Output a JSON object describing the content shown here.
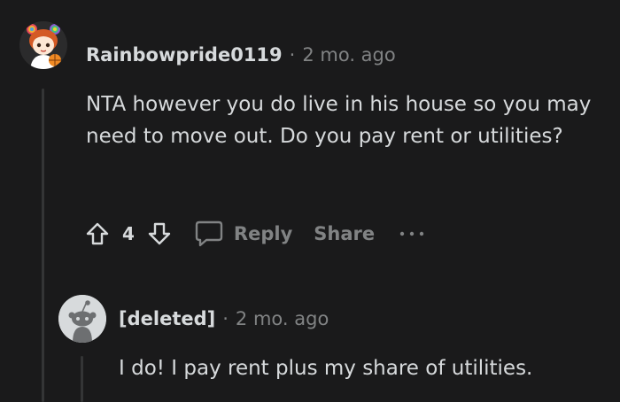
{
  "comment": {
    "author": "Rainbowpride0119",
    "separator": "·",
    "time": "2 mo. ago",
    "body": "NTA however you do live in his house so you may need to move out. Do you pay rent or utilities?",
    "votes": "4",
    "reply_label": "Reply",
    "share_label": "Share",
    "more_label": "···"
  },
  "reply": {
    "author": "[deleted]",
    "separator": "·",
    "time": "2 mo. ago",
    "body": "I do! I pay rent plus my share of utilities."
  },
  "icons": {
    "upvote": "arrow-up-icon",
    "downvote": "arrow-down-icon",
    "reply": "speech-bubble-icon",
    "more": "ellipsis-icon",
    "avatar_main": "anime-girl-avatar",
    "avatar_reply": "deleted-user-avatar"
  },
  "colors": {
    "background": "#1a1a1b",
    "text": "#d7dadc",
    "muted": "#818384",
    "thread_line": "#343536"
  }
}
